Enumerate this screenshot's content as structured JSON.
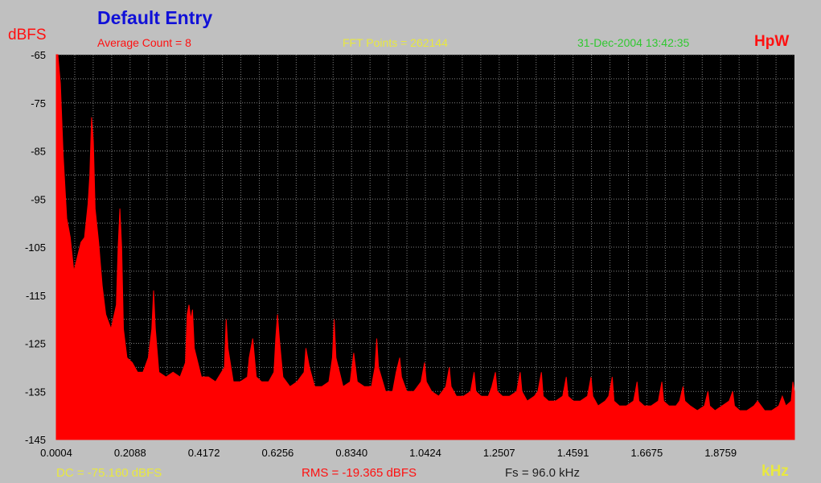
{
  "header": {
    "title": "Default Entry",
    "unit_code": "HpW",
    "average_count": "Average Count = 8",
    "fft_points": "FFT Points = 262144",
    "timestamp": "31-Dec-2004 13:42:35"
  },
  "footer": {
    "dc": "DC = -75.160 dBFS",
    "rms": "RMS = -19.365 dBFS",
    "fs": "Fs = 96.0 kHz"
  },
  "colors": {
    "background": "#c0c0c0",
    "plot_background": "#000000",
    "grid": "#808080",
    "trace": "#ff0000",
    "title": "#1010d8",
    "label_red": "#ff1010",
    "label_yellow": "#e8e840",
    "label_green": "#30c830"
  },
  "chart_data": {
    "type": "area",
    "title": "Default Entry",
    "xlabel": "kHz",
    "ylabel": "dBFS",
    "xlim": [
      0.0004,
      2.0843
    ],
    "ylim": [
      -145,
      -65
    ],
    "x_ticks": [
      "0.0004",
      "0.2088",
      "0.4172",
      "0.6256",
      "0.8340",
      "1.0424",
      "1.2507",
      "1.4591",
      "1.6675",
      "1.8759"
    ],
    "y_ticks": [
      "-65",
      "-75",
      "-85",
      "-95",
      "-105",
      "-115",
      "-125",
      "-135",
      "-145"
    ],
    "grid": true,
    "series": [
      {
        "values": [
          [
            0.0004,
            -65
          ],
          [
            0.005,
            -65
          ],
          [
            0.012,
            -71
          ],
          [
            0.02,
            -86
          ],
          [
            0.03,
            -99
          ],
          [
            0.04,
            -103
          ],
          [
            0.05,
            -110
          ],
          [
            0.06,
            -107
          ],
          [
            0.07,
            -104
          ],
          [
            0.08,
            -103
          ],
          [
            0.09,
            -96
          ],
          [
            0.095,
            -90
          ],
          [
            0.1,
            -78
          ],
          [
            0.105,
            -83
          ],
          [
            0.11,
            -97
          ],
          [
            0.12,
            -104
          ],
          [
            0.13,
            -113
          ],
          [
            0.14,
            -119
          ],
          [
            0.155,
            -122
          ],
          [
            0.17,
            -117
          ],
          [
            0.175,
            -105
          ],
          [
            0.18,
            -97
          ],
          [
            0.185,
            -105
          ],
          [
            0.19,
            -122
          ],
          [
            0.2,
            -128
          ],
          [
            0.215,
            -129
          ],
          [
            0.23,
            -131
          ],
          [
            0.245,
            -131
          ],
          [
            0.26,
            -128
          ],
          [
            0.27,
            -122
          ],
          [
            0.275,
            -114
          ],
          [
            0.28,
            -122
          ],
          [
            0.29,
            -131
          ],
          [
            0.31,
            -132
          ],
          [
            0.33,
            -131
          ],
          [
            0.35,
            -132
          ],
          [
            0.365,
            -129
          ],
          [
            0.37,
            -119
          ],
          [
            0.375,
            -117
          ],
          [
            0.38,
            -120
          ],
          [
            0.385,
            -118
          ],
          [
            0.39,
            -126
          ],
          [
            0.41,
            -132
          ],
          [
            0.43,
            -132
          ],
          [
            0.45,
            -133
          ],
          [
            0.475,
            -130
          ],
          [
            0.48,
            -120
          ],
          [
            0.485,
            -126
          ],
          [
            0.5,
            -133
          ],
          [
            0.52,
            -133
          ],
          [
            0.54,
            -132
          ],
          [
            0.545,
            -128
          ],
          [
            0.555,
            -124
          ],
          [
            0.565,
            -132
          ],
          [
            0.58,
            -133
          ],
          [
            0.6,
            -133
          ],
          [
            0.615,
            -131
          ],
          [
            0.62,
            -124
          ],
          [
            0.625,
            -119
          ],
          [
            0.63,
            -124
          ],
          [
            0.64,
            -132
          ],
          [
            0.66,
            -134
          ],
          [
            0.68,
            -133
          ],
          [
            0.7,
            -131
          ],
          [
            0.705,
            -126
          ],
          [
            0.715,
            -130
          ],
          [
            0.73,
            -134
          ],
          [
            0.75,
            -134
          ],
          [
            0.77,
            -133
          ],
          [
            0.78,
            -128
          ],
          [
            0.785,
            -120
          ],
          [
            0.79,
            -128
          ],
          [
            0.81,
            -134
          ],
          [
            0.83,
            -133
          ],
          [
            0.84,
            -127
          ],
          [
            0.85,
            -133
          ],
          [
            0.87,
            -134
          ],
          [
            0.89,
            -134
          ],
          [
            0.9,
            -130
          ],
          [
            0.905,
            -124
          ],
          [
            0.91,
            -130
          ],
          [
            0.93,
            -135
          ],
          [
            0.95,
            -135
          ],
          [
            0.96,
            -131
          ],
          [
            0.97,
            -128
          ],
          [
            0.975,
            -132
          ],
          [
            0.99,
            -135
          ],
          [
            1.01,
            -135
          ],
          [
            1.03,
            -133
          ],
          [
            1.04,
            -129
          ],
          [
            1.045,
            -133
          ],
          [
            1.06,
            -135
          ],
          [
            1.08,
            -136
          ],
          [
            1.1,
            -134
          ],
          [
            1.11,
            -130
          ],
          [
            1.115,
            -134
          ],
          [
            1.13,
            -136
          ],
          [
            1.15,
            -136
          ],
          [
            1.17,
            -135
          ],
          [
            1.18,
            -131
          ],
          [
            1.185,
            -135
          ],
          [
            1.2,
            -136
          ],
          [
            1.22,
            -136
          ],
          [
            1.23,
            -134
          ],
          [
            1.24,
            -131
          ],
          [
            1.245,
            -135
          ],
          [
            1.26,
            -136
          ],
          [
            1.28,
            -136
          ],
          [
            1.3,
            -135
          ],
          [
            1.31,
            -131
          ],
          [
            1.315,
            -135
          ],
          [
            1.33,
            -137
          ],
          [
            1.35,
            -136
          ],
          [
            1.36,
            -135
          ],
          [
            1.37,
            -131
          ],
          [
            1.375,
            -136
          ],
          [
            1.39,
            -137
          ],
          [
            1.41,
            -137
          ],
          [
            1.43,
            -136
          ],
          [
            1.44,
            -132
          ],
          [
            1.445,
            -136
          ],
          [
            1.46,
            -137
          ],
          [
            1.48,
            -137
          ],
          [
            1.5,
            -136
          ],
          [
            1.51,
            -132
          ],
          [
            1.515,
            -136
          ],
          [
            1.53,
            -138
          ],
          [
            1.55,
            -137
          ],
          [
            1.56,
            -136
          ],
          [
            1.57,
            -132
          ],
          [
            1.575,
            -137
          ],
          [
            1.59,
            -138
          ],
          [
            1.61,
            -138
          ],
          [
            1.63,
            -137
          ],
          [
            1.64,
            -133
          ],
          [
            1.645,
            -137
          ],
          [
            1.66,
            -138
          ],
          [
            1.68,
            -138
          ],
          [
            1.7,
            -137
          ],
          [
            1.71,
            -133
          ],
          [
            1.715,
            -137
          ],
          [
            1.73,
            -138
          ],
          [
            1.75,
            -138
          ],
          [
            1.76,
            -137
          ],
          [
            1.77,
            -134
          ],
          [
            1.775,
            -137
          ],
          [
            1.79,
            -138
          ],
          [
            1.81,
            -139
          ],
          [
            1.83,
            -138
          ],
          [
            1.84,
            -135
          ],
          [
            1.845,
            -138
          ],
          [
            1.86,
            -139
          ],
          [
            1.88,
            -138
          ],
          [
            1.9,
            -137
          ],
          [
            1.91,
            -135
          ],
          [
            1.915,
            -138
          ],
          [
            1.93,
            -139
          ],
          [
            1.95,
            -139
          ],
          [
            1.97,
            -138
          ],
          [
            1.98,
            -137
          ],
          [
            2.0,
            -139
          ],
          [
            2.02,
            -139
          ],
          [
            2.04,
            -138
          ],
          [
            2.05,
            -136
          ],
          [
            2.06,
            -138
          ],
          [
            2.075,
            -137
          ],
          [
            2.08,
            -133
          ],
          [
            2.0843,
            -135
          ]
        ]
      }
    ]
  }
}
